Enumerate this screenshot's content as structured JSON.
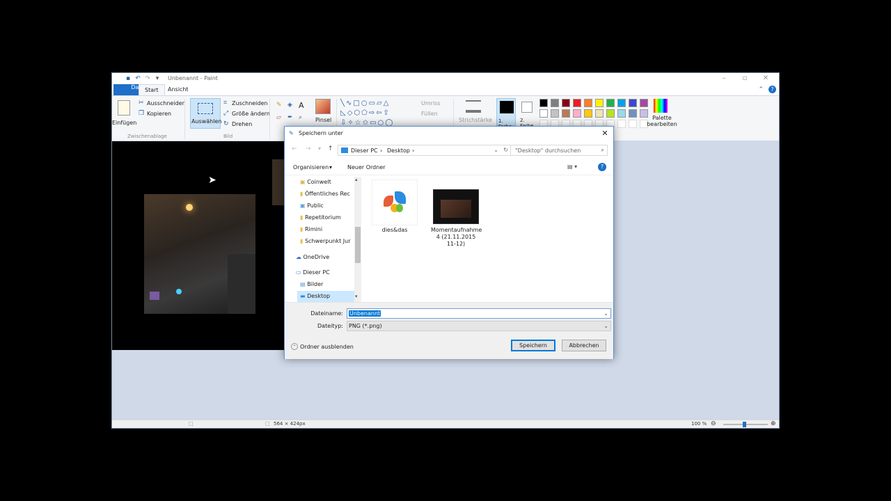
{
  "paint": {
    "window_title": "Unbenannt - Paint",
    "tabs": [
      {
        "label": "Datei"
      },
      {
        "label": "Start"
      },
      {
        "label": "Ansicht"
      }
    ],
    "ribbon": {
      "clipboard": {
        "paste": "Einfügen",
        "cut": "Ausschneiden",
        "copy": "Kopieren",
        "group": "Zwischenablage"
      },
      "image": {
        "select": "Auswählen",
        "crop": "Zuschneiden",
        "resize": "Größe ändern",
        "rotate": "Drehen",
        "group": "Bild"
      },
      "brushes": "Pinsel",
      "shapes": {
        "outline": "Umriss",
        "fill": "Füllen"
      },
      "size": "Strichstärke",
      "color1": "1. Farbe",
      "color2": "2. Farbe",
      "edit_colors": "Palette bearbeiten",
      "palette_row1": [
        "#000000",
        "#7f7f7f",
        "#880015",
        "#ed1c24",
        "#ff7f27",
        "#fff200",
        "#22b14c",
        "#00a2e8",
        "#3f48cc",
        "#a349a4"
      ],
      "palette_row2": [
        "#ffffff",
        "#c3c3c3",
        "#b97a57",
        "#ffaec9",
        "#ffc90e",
        "#efe4b0",
        "#b5e61d",
        "#99d9ea",
        "#7092be",
        "#c8bfe7"
      ]
    },
    "statusbar": {
      "dimensions": "564 × 424px",
      "zoom": "100 %"
    }
  },
  "dialog": {
    "title": "Speichern unter",
    "breadcrumb": [
      "Dieser PC",
      "Desktop"
    ],
    "search_placeholder": "\"Desktop\" durchsuchen",
    "organize": "Organisieren",
    "new_folder": "Neuer Ordner",
    "nav": [
      {
        "label": "Coinwelt",
        "icon": "user-folder-icon"
      },
      {
        "label": "Öffentliches Rec",
        "icon": "folder-icon"
      },
      {
        "label": "Public",
        "icon": "user-folder-icon"
      },
      {
        "label": "Repetitorium",
        "icon": "folder-icon"
      },
      {
        "label": "Rimini",
        "icon": "folder-icon"
      },
      {
        "label": "Schwerpunkt Jur",
        "icon": "folder-icon"
      },
      {
        "label": "OneDrive",
        "icon": "cloud-icon"
      },
      {
        "label": "Dieser PC",
        "icon": "computer-icon"
      },
      {
        "label": "Bilder",
        "icon": "pictures-icon"
      },
      {
        "label": "Desktop",
        "icon": "desktop-icon"
      }
    ],
    "files": [
      {
        "name": "dies&das",
        "icon": "msn-butterfly-icon"
      },
      {
        "name": "Momentaufnahme 4 (21.11.2015 11-12)",
        "icon": "video-thumbnail-icon"
      }
    ],
    "filename_label": "Dateiname:",
    "filename_value": "Unbenannt",
    "filetype_label": "Dateityp:",
    "filetype_value": "PNG (*.png)",
    "hide_folders": "Ordner ausblenden",
    "save": "Speichern",
    "cancel": "Abbrechen"
  }
}
